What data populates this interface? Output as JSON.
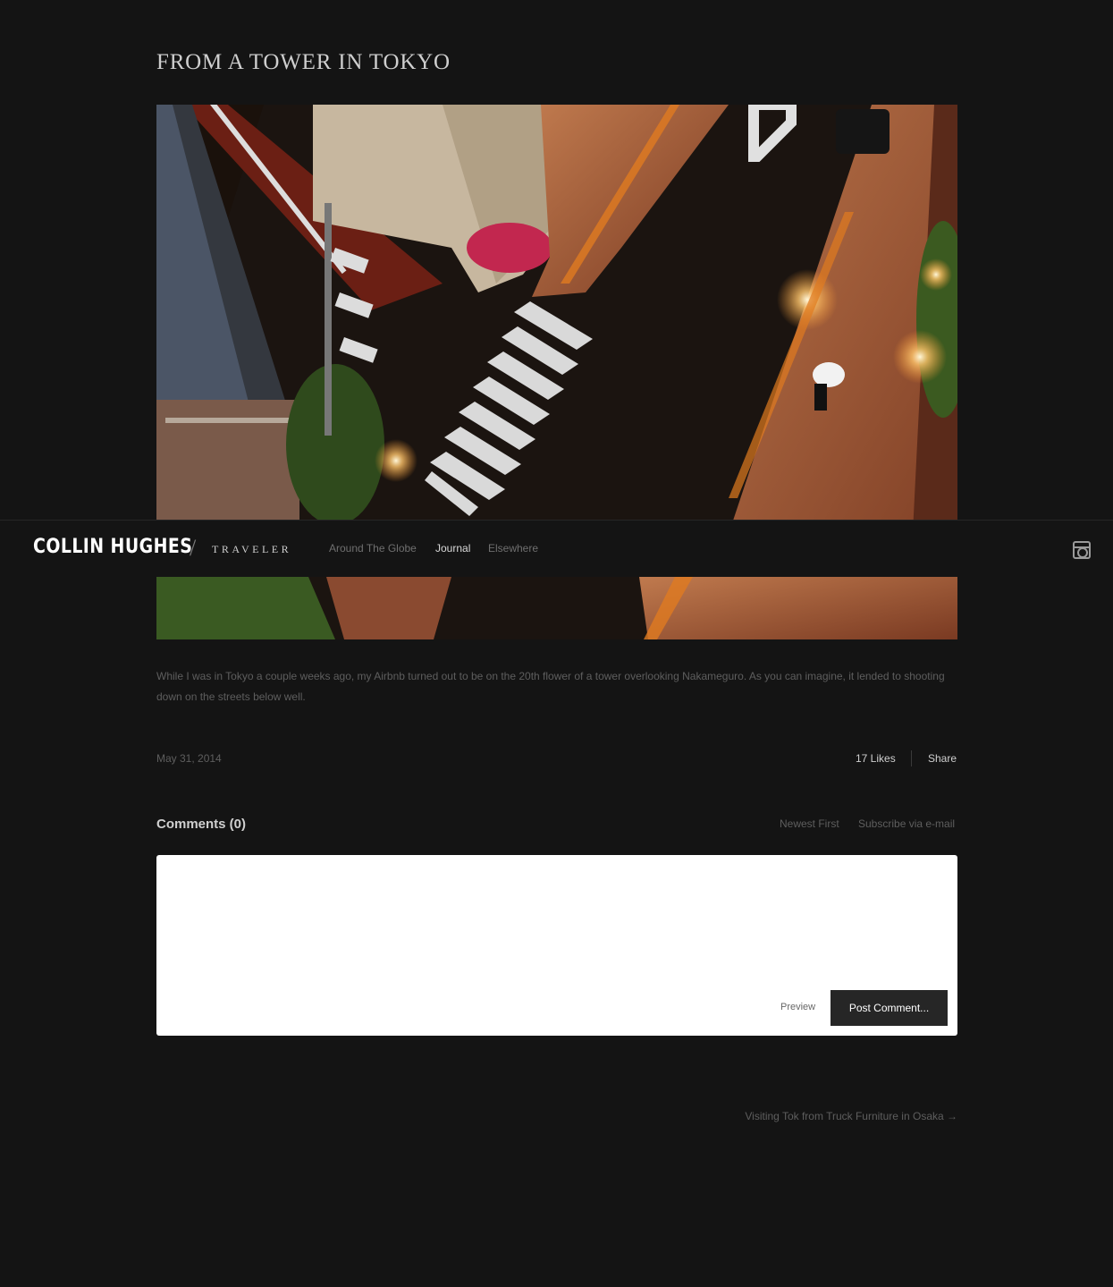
{
  "post": {
    "title": "FROM A TOWER IN TOKYO",
    "body": "While I was in Tokyo a couple weeks ago, my Airbnb turned out to be on the 20th flower of a tower overlooking Nakameguro. As you can imagine, it lended to shooting down on the streets below well.",
    "date": "May 31, 2014",
    "likes": "17 Likes",
    "share": "Share"
  },
  "nav": {
    "brand": "COLLIN HUGHES",
    "separator": "/",
    "subtitle": "TRAVELER",
    "links": [
      {
        "label": "Around The Globe",
        "active": false
      },
      {
        "label": "Journal",
        "active": true
      },
      {
        "label": "Elsewhere",
        "active": false
      }
    ],
    "social_icon": "instagram-icon"
  },
  "comments": {
    "heading": "Comments (0)",
    "sort_label": "Newest First",
    "subscribe_label": "Subscribe via e-mail",
    "textarea_value": "",
    "preview_label": "Preview",
    "submit_label": "Post Comment..."
  },
  "pagination": {
    "next_label": "Visiting Tok from Truck Furniture in Osaka →"
  },
  "colors": {
    "background": "#141414",
    "text_muted": "#5e5e5e",
    "text_light": "#cfcfcf",
    "button_dark": "#262626"
  }
}
